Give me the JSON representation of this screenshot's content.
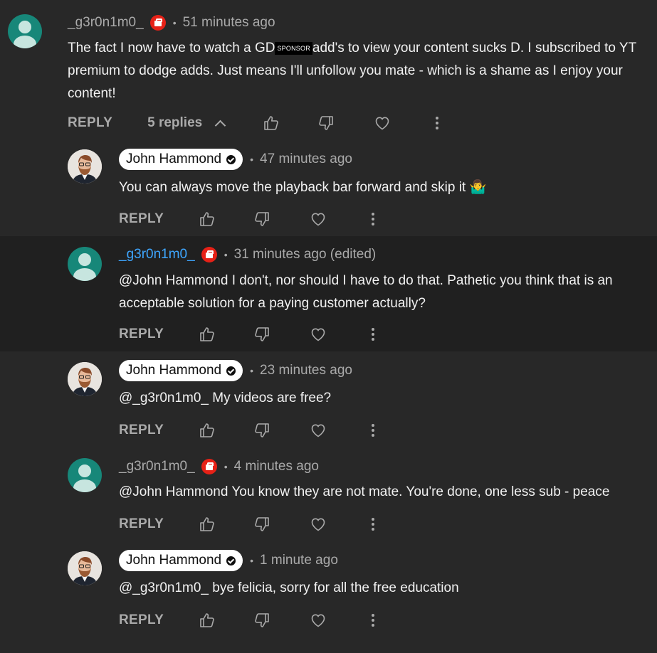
{
  "comments": [
    {
      "author": "_g3r0n1m0_",
      "time": "51 minutes ago",
      "text_before": "The fact I now have to watch a GD",
      "sponsor_tag": "SPONSOR",
      "text_after": "add's to view your content sucks D. I subscribed to YT premium to dodge adds. Just means I'll unfollow you mate - which is a shame as I enjoy your content!",
      "reply_label": "REPLY",
      "replies_label": "5 replies"
    },
    {
      "author": "John Hammond",
      "time": "47 minutes ago",
      "text": "You can always move the playback bar forward and skip it 🤷‍♂️",
      "reply_label": "REPLY"
    },
    {
      "author": "_g3r0n1m0_",
      "time": "31 minutes ago (edited)",
      "text": " @John Hammond  I don't, nor should I have to do that. Pathetic you think that is an acceptable solution for a paying customer actually?",
      "reply_label": "REPLY"
    },
    {
      "author": "John Hammond",
      "time": "23 minutes ago",
      "text": " @_g3r0n1m0_  My videos are free?",
      "reply_label": "REPLY"
    },
    {
      "author": "_g3r0n1m0_",
      "time": "4 minutes ago",
      "text": " @John Hammond  You know they are not mate. You're done, one less sub - peace",
      "reply_label": "REPLY"
    },
    {
      "author": "John Hammond",
      "time": "1 minute ago",
      "text": " @_g3r0n1m0_  bye felicia, sorry for all the free education",
      "reply_label": "REPLY"
    }
  ],
  "separator": "•",
  "colors": {
    "background": "#282828",
    "highlight": "#202020",
    "link": "#3ea6ff",
    "member_badge": "#e62117",
    "avatar_default": "#178779"
  },
  "icons": [
    "thumbs-up-icon",
    "thumbs-down-icon",
    "heart-icon",
    "more-vert-icon",
    "chevron-up-icon",
    "verified-check-icon",
    "member-badge-icon"
  ]
}
